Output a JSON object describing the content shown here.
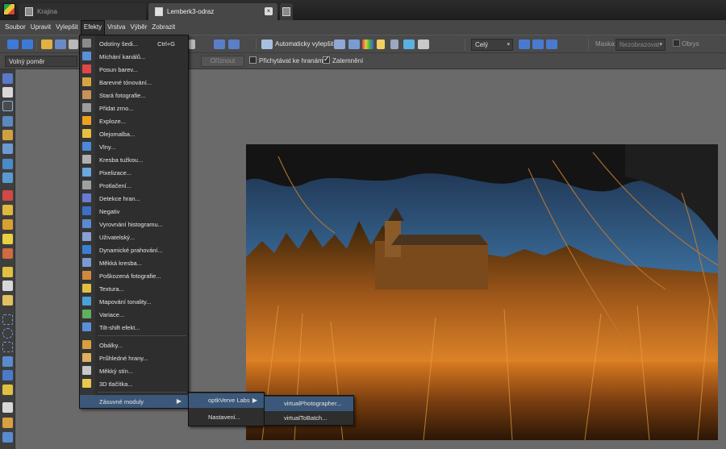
{
  "tabs": [
    {
      "label": "Krajina",
      "active": false
    },
    {
      "label": "Lemberk3-odraz",
      "active": true
    }
  ],
  "menubar": [
    "Soubor",
    "Upravit",
    "Vylepšit",
    "Efekty",
    "Vrstva",
    "Výběr",
    "Zobrazit"
  ],
  "toolbar": {
    "auto_enhance_label": "Automaticky vylepšit",
    "zoom_value": "Celý",
    "mask_label": "Maska:",
    "mask_value": "Nezobrazovat",
    "outline_label": "Obrys"
  },
  "optionbar": {
    "ratio_value": "Volný poměr",
    "crop_button": "Oříznout",
    "snap_label": "Přichytávat ke hranám",
    "snap_checked": false,
    "darken_label": "Zatemnění",
    "darken_checked": true
  },
  "effects_menu": {
    "items": [
      {
        "label": "Odstíny šedi...",
        "shortcut": "Ctrl+G",
        "icon": "grayscale-icon",
        "color": "#8a8a8a"
      },
      {
        "label": "Míchání kanálů...",
        "icon": "channel-mixer-icon",
        "color": "#5b8fd6"
      },
      {
        "label": "Posun barev...",
        "icon": "color-shift-icon",
        "color": "#e04848"
      },
      {
        "label": "Barevné tónování...",
        "icon": "color-toning-icon",
        "color": "#d9a441"
      },
      {
        "label": "Stará fotografie...",
        "icon": "old-photo-icon",
        "color": "#c9925a"
      },
      {
        "label": "Přidat zrno...",
        "icon": "grain-icon",
        "color": "#9c9c9c"
      },
      {
        "label": "Exploze...",
        "icon": "explosion-icon",
        "color": "#f0a020"
      },
      {
        "label": "Olejomalba...",
        "icon": "oil-paint-icon",
        "color": "#e8c040"
      },
      {
        "label": "Vlny...",
        "icon": "waves-icon",
        "color": "#4a8ad8"
      },
      {
        "label": "Kresba tužkou...",
        "icon": "pencil-sketch-icon",
        "color": "#b0b0b0"
      },
      {
        "label": "Pixelizace...",
        "icon": "pixelize-icon",
        "color": "#6aa8e0"
      },
      {
        "label": "Protlačení...",
        "icon": "emboss-icon",
        "color": "#a0a0a0"
      },
      {
        "label": "Detekce hran...",
        "icon": "edge-detect-icon",
        "color": "#6a7ad0"
      },
      {
        "label": "Negativ",
        "icon": "negative-icon",
        "color": "#3a70c8"
      },
      {
        "label": "Vyrovnání histogramu...",
        "icon": "histogram-icon",
        "color": "#5a8ad0"
      },
      {
        "label": "Uživatelský...",
        "icon": "user-filter-icon",
        "color": "#8aa0d0"
      },
      {
        "label": "Dynamické prahování...",
        "icon": "threshold-icon",
        "color": "#3a80d0"
      },
      {
        "label": "Měkká kresba...",
        "icon": "soft-drawing-icon",
        "color": "#7a9ad0"
      },
      {
        "label": "Poškozená fotografie...",
        "icon": "damaged-photo-icon",
        "color": "#d08a40"
      },
      {
        "label": "Textura...",
        "icon": "texture-icon",
        "color": "#e0c040"
      },
      {
        "label": "Mapování tonality...",
        "icon": "tone-mapping-icon",
        "color": "#4aa0d8"
      },
      {
        "label": "Variace...",
        "icon": "variations-icon",
        "color": "#60b060"
      },
      {
        "label": "Tilt-shift efekt...",
        "icon": "tilt-shift-icon",
        "color": "#5a90d8"
      },
      {
        "label": "Obálky...",
        "icon": "envelope-icon",
        "color": "#d8a040"
      },
      {
        "label": "Průhledné hrany...",
        "icon": "transparent-edges-icon",
        "color": "#e0b060"
      },
      {
        "label": "Měkký stín...",
        "icon": "soft-shadow-icon",
        "color": "#c8c8c8"
      },
      {
        "label": "3D tlačítka...",
        "icon": "3d-button-icon",
        "color": "#e8c850"
      },
      {
        "label": "Zásuvné moduly",
        "icon": "plugins-icon",
        "color": "#3b587a",
        "submenu": true
      }
    ]
  },
  "plugins_submenu": [
    {
      "label": "optkVerve Labs",
      "submenu": true
    },
    {
      "label": "Nastavení..."
    }
  ],
  "verve_submenu": [
    {
      "label": "virtualPhotographer..."
    },
    {
      "label": "virtualToBatch..."
    }
  ]
}
